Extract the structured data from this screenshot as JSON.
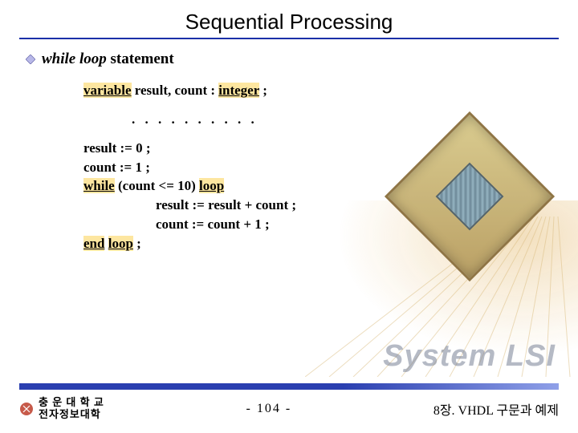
{
  "title": "Sequential Processing",
  "bullet": {
    "ital": "while loop",
    "rest": " statement"
  },
  "code": {
    "decl_kw_variable": "variable",
    "decl_mid": " result, count : ",
    "decl_kw_integer": "integer",
    "decl_end": " ;",
    "dots": ". . . . . . . . . .",
    "l1": "result := 0 ;",
    "l2": "count := 1 ;",
    "l3_kw_while": "while",
    "l3_mid": " (count <= 10) ",
    "l3_kw_loop": "loop",
    "l4": "result := result + count ;",
    "l5": "count := count + 1 ;",
    "l6_kw_end": "end",
    "l6_sp": " ",
    "l6_kw_loop": "loop",
    "l6_end": " ;"
  },
  "watermark": "System LSI",
  "footer": {
    "uni_line1": "충 운 대 학 교",
    "uni_line2": "전자정보대학",
    "page": "-  104  -",
    "chapter": "8장. VHDL 구문과 예제"
  }
}
